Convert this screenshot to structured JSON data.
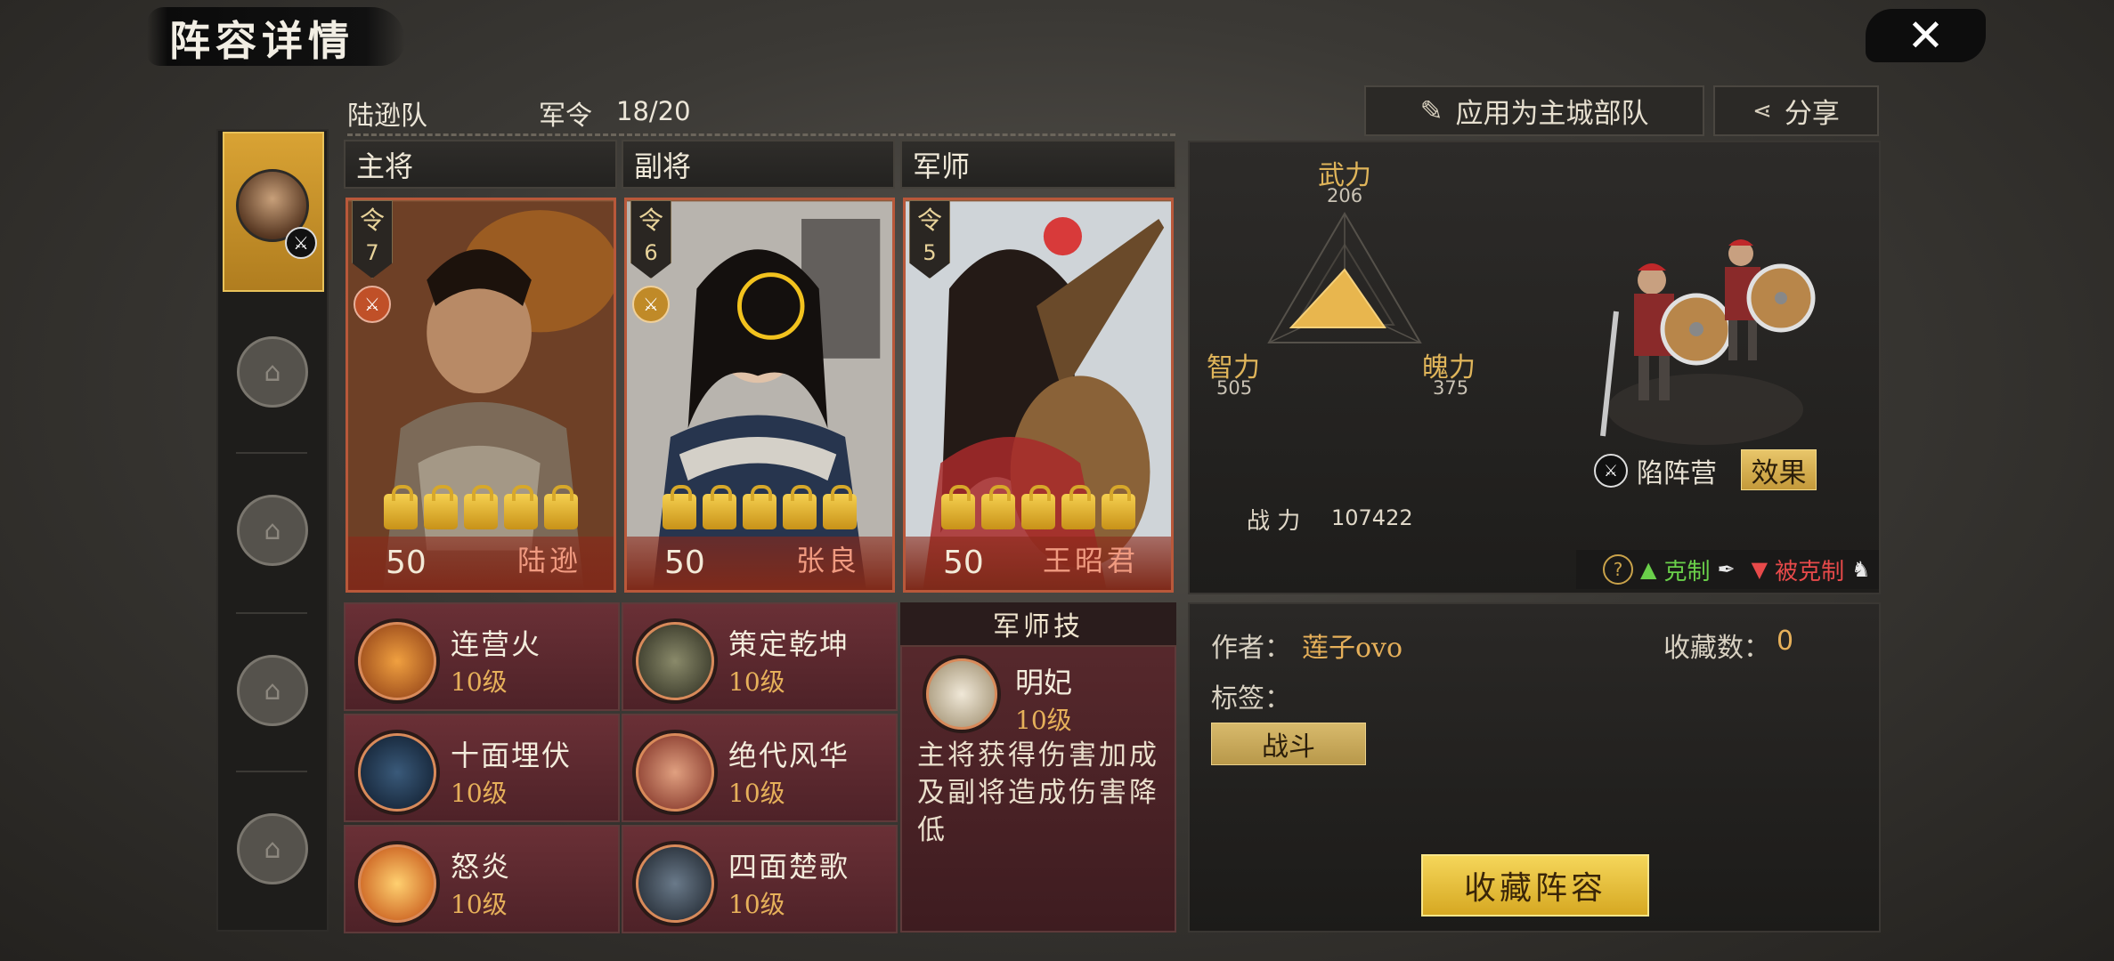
{
  "header": {
    "title": "阵容详情",
    "close_glyph": "✕"
  },
  "team": {
    "name": "陆逊队",
    "order_label": "军令",
    "order_value": "18/20"
  },
  "actions": {
    "apply_label": "应用为主城部队",
    "share_label": "分享"
  },
  "roles": {
    "main": "主将",
    "vice": "副将",
    "strategist": "军师"
  },
  "heroes": [
    {
      "ling": "令",
      "cost": "7",
      "level": "50",
      "name": "陆逊",
      "stars": 5,
      "accent": "#b9583a"
    },
    {
      "ling": "令",
      "cost": "6",
      "level": "50",
      "name": "张良",
      "stars": 5,
      "accent": "#b9583a"
    },
    {
      "ling": "令",
      "cost": "5",
      "level": "50",
      "name": "王昭君",
      "stars": 5,
      "accent": "#b9583a"
    }
  ],
  "skills": [
    [
      {
        "name": "连营火",
        "level": "10级"
      },
      {
        "name": "十面埋伏",
        "level": "10级"
      },
      {
        "name": "怒炎",
        "level": "10级"
      }
    ],
    [
      {
        "name": "策定乾坤",
        "level": "10级"
      },
      {
        "name": "绝代风华",
        "level": "10级"
      },
      {
        "name": "四面楚歌",
        "level": "10级"
      }
    ]
  ],
  "strategist_skill": {
    "header": "军师技",
    "name": "明妃",
    "level": "10级",
    "description": "主将获得伤害加成及副将造成伤害降低"
  },
  "stats": {
    "force_label": "武力",
    "force_value": "206",
    "intellect_label": "智力",
    "intellect_value": "505",
    "spirit_label": "魄力",
    "spirit_value": "375",
    "power_label": "战 力",
    "power_value": "107422"
  },
  "troop": {
    "name": "陷阵营",
    "effect_label": "效果"
  },
  "counter": {
    "help": "?",
    "counters_label": "克制",
    "countered_label": "被克制"
  },
  "info": {
    "author_label": "作者：",
    "author_value": "莲子ovo",
    "fav_count_label": "收藏数：",
    "fav_count_value": "0",
    "tags_label": "标签：",
    "tag_value": "战斗",
    "favorite_button": "收藏阵容"
  },
  "colors": {
    "gold": "#e6b05a",
    "panel": "#2d2b29",
    "card_border": "#b9583a",
    "counter_green": "#6ad04a",
    "counter_red": "#e84a4a"
  }
}
